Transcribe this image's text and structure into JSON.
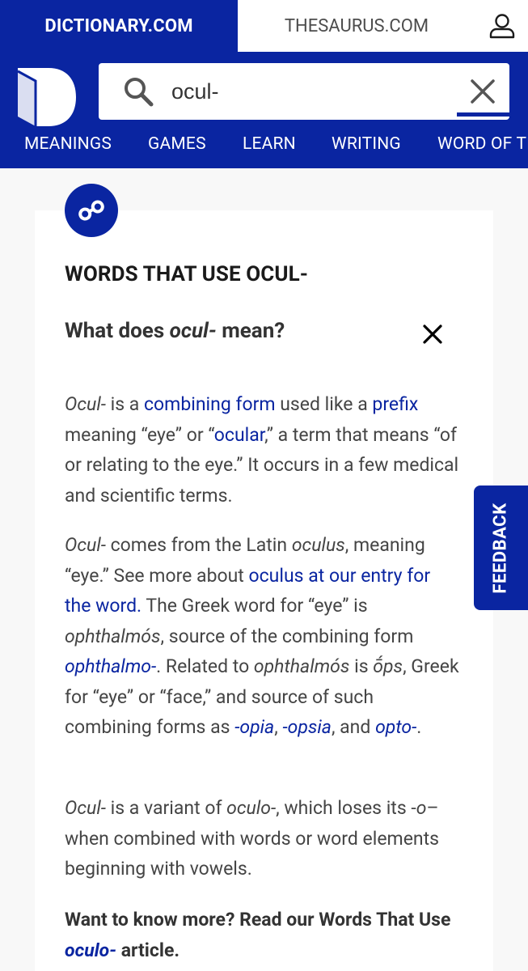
{
  "topbar": {
    "dictionary_tab": "DICTIONARY.COM",
    "thesaurus_tab": "THESAURUS.COM"
  },
  "search": {
    "value": "ocul-"
  },
  "nav": {
    "items": [
      "MEANINGS",
      "GAMES",
      "LEARN",
      "WRITING",
      "WORD OF THE DAY"
    ]
  },
  "card": {
    "title": "WORDS THAT USE OCUL-",
    "question_pre": "What does ",
    "question_term": "ocul-",
    "question_post": " mean?"
  },
  "para1": {
    "t1": "Ocul-",
    "t2": " is a ",
    "link_combining_form": "combining form",
    "t3": " used like a ",
    "link_prefix": "prefix",
    "t4": " meaning “eye” or “",
    "link_ocular": "ocular",
    "t5": ",” a term that means “of or relating to the eye.” It occurs in a few medical and scientific terms."
  },
  "para2": {
    "t1": "Ocul-",
    "t2": " comes from the Latin ",
    "t3": "oculus",
    "t4": ", meaning “eye.” See more about ",
    "link_oculus": "oculus at our entry for the word.",
    "t5": " The Greek word for “eye” is ",
    "t6": "ophthalmós",
    "t7": ", source of the combining form ",
    "link_ophthalmo": "ophthalmo-",
    "t8": ". Related to ",
    "t9": "ophthalmós",
    "t10": " is ",
    "t11": "ṓps",
    "t12": ", Greek for “eye” or “face,” and source of such combining forms as ",
    "link_opia": "-opia",
    "t13": ", ",
    "link_opsia": "-opsia",
    "t14": ", and ",
    "link_opto": "opto-",
    "t15": "."
  },
  "para3": {
    "t1": "Ocul-",
    "t2": " is a variant of ",
    "t3": "oculo-",
    "t4": ", which loses its -",
    "t5": "o",
    "t6": "– when combined with words or word elements beginning with vowels."
  },
  "para4": {
    "t1": "Want to know more? Read our Words That Use ",
    "link_oculo": "oculo-",
    "t2": " article."
  },
  "feedback": {
    "label": "FEEDBACK"
  },
  "colors": {
    "brand_blue": "#0a25a1",
    "background": "#f8f8f8",
    "text": "#454545"
  },
  "icons": [
    "user-icon",
    "dictionary-logo",
    "search-icon",
    "clear-icon",
    "link-icon",
    "close-icon"
  ]
}
